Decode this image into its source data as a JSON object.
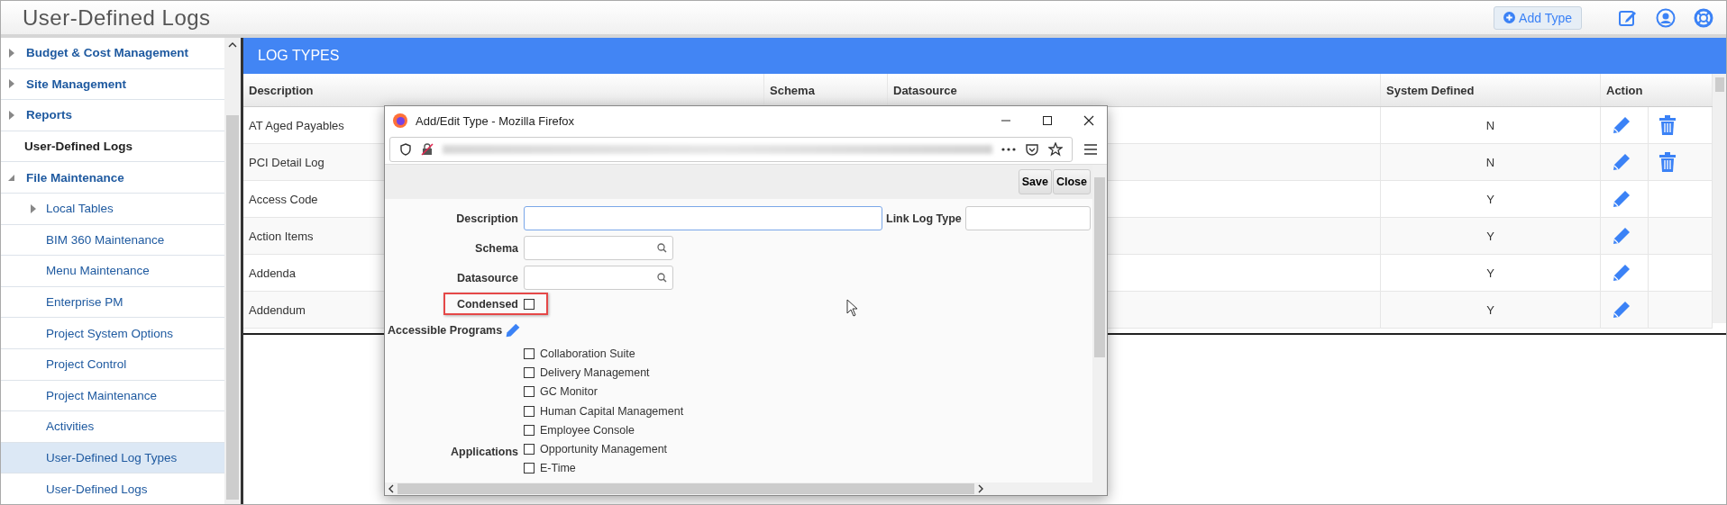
{
  "header": {
    "title": "User-Defined Logs",
    "add_button": "Add Type"
  },
  "sidebar": {
    "items": [
      {
        "label": "Budget & Cost Management",
        "kind": "group",
        "expanded": false,
        "selected": false
      },
      {
        "label": "Site Management",
        "kind": "group",
        "expanded": false,
        "selected": false
      },
      {
        "label": "Reports",
        "kind": "group",
        "expanded": false,
        "selected": false
      },
      {
        "label": "User-Defined Logs",
        "kind": "heading",
        "selected": false
      },
      {
        "label": "File Maintenance",
        "kind": "group",
        "expanded": true,
        "selected": false,
        "children": [
          {
            "label": "Local Tables",
            "kind": "group",
            "expanded": false,
            "selected": false
          },
          {
            "label": "BIM 360 Maintenance",
            "kind": "link",
            "selected": false
          },
          {
            "label": "Menu Maintenance",
            "kind": "link",
            "selected": false
          },
          {
            "label": "Enterprise PM",
            "kind": "link",
            "selected": false
          },
          {
            "label": "Project System Options",
            "kind": "link",
            "selected": false
          },
          {
            "label": "Project Control",
            "kind": "link",
            "selected": false
          },
          {
            "label": "Project Maintenance",
            "kind": "link",
            "selected": false
          },
          {
            "label": "Activities",
            "kind": "link",
            "selected": false
          },
          {
            "label": "User-Defined Log Types",
            "kind": "link",
            "selected": true
          },
          {
            "label": "User-Defined Logs",
            "kind": "link",
            "selected": false
          }
        ]
      }
    ]
  },
  "table": {
    "title": "LOG TYPES",
    "columns": [
      "Description",
      "Schema",
      "Datasource",
      "System Defined",
      "Action"
    ],
    "rows": [
      {
        "description": "AT Aged Payables",
        "system_defined": "N",
        "deletable": true
      },
      {
        "description": "PCI Detail Log",
        "system_defined": "N",
        "deletable": true
      },
      {
        "description": "Access Code",
        "system_defined": "Y",
        "deletable": false
      },
      {
        "description": "Action Items",
        "system_defined": "Y",
        "deletable": false
      },
      {
        "description": "Addenda",
        "system_defined": "Y",
        "deletable": false
      },
      {
        "description": "Addendum",
        "system_defined": "Y",
        "deletable": false
      }
    ]
  },
  "dialog": {
    "title": "Add/Edit Type - Mozilla Firefox",
    "buttons": [
      "Save",
      "Close"
    ],
    "description": {
      "label": "Description"
    },
    "link_log_type": {
      "label": "Link Log Type"
    },
    "schema": {
      "label": "Schema"
    },
    "datasource": {
      "label": "Datasource"
    },
    "condensed": {
      "label": "Condensed",
      "checked": false
    },
    "accessible_programs": "Accessible Programs",
    "applications": {
      "label": "Applications",
      "items": [
        {
          "label": "Collaboration Suite",
          "checked": false
        },
        {
          "label": "Delivery Management",
          "checked": false
        },
        {
          "label": "GC Monitor",
          "checked": false
        },
        {
          "label": "Human Capital Management",
          "checked": false
        },
        {
          "label": "Employee Console",
          "checked": false
        },
        {
          "label": "Opportunity Management",
          "checked": false
        },
        {
          "label": "E-Time",
          "checked": false
        }
      ]
    }
  }
}
